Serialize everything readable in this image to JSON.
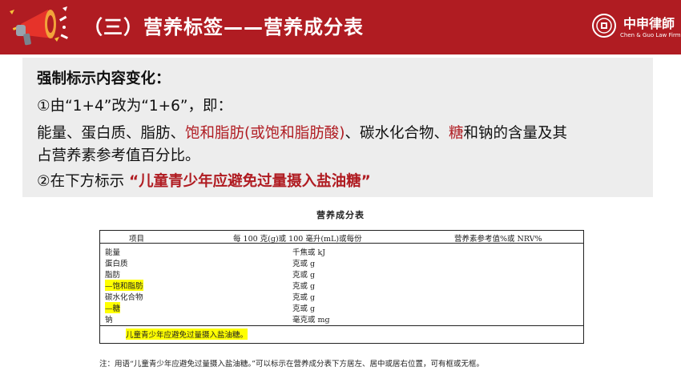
{
  "header": {
    "title": "（三）营养标签——营养成分表",
    "logo_cn": "中申律師",
    "logo_en": "Chen & Guo Law Firm"
  },
  "content": {
    "line1": "强制标示内容变化：",
    "line2": "①由“1+4”改为“1+6”，即：",
    "line3_a": "能量、蛋白质、脂肪、",
    "line3_b": "饱和脂肪(或饱和脂肪酸)",
    "line3_c": "、碳水化合物、",
    "line3_d": "糖",
    "line3_e": "和钠的含量及其",
    "line4": "占营养素参考值百分比。",
    "line5_a": "②在下方标示",
    "line5_b": "“儿童青少年应避免过量摄入盐油糖”"
  },
  "nutrition_table": {
    "title": "营养成分表",
    "headers": [
      "项目",
      "每 100 克(g)或 100 毫升(mL)或每份",
      "营养素参考值%或 NRV%"
    ],
    "rows": [
      {
        "name": "能量",
        "unit": "千焦或 kJ",
        "highlight": false
      },
      {
        "name": "蛋白质",
        "unit": "克或 g",
        "highlight": false
      },
      {
        "name": "脂肪",
        "unit": "克或 g",
        "highlight": false
      },
      {
        "name": "—饱和脂肪",
        "unit": "克或 g",
        "highlight": true
      },
      {
        "name": "碳水化合物",
        "unit": "克或 g",
        "highlight": false
      },
      {
        "name": "—糖",
        "unit": "克或 g",
        "highlight": true
      },
      {
        "name": "钠",
        "unit": "毫克或 mg",
        "highlight": false
      }
    ],
    "advice": "儿童青少年应避免过量摄入盐油糖。"
  },
  "note": "注：用语“儿童青少年应避免过量摄入盐油糖。”可以标示在营养成分表下方居左、居中或居右位置，可有框或无框。",
  "colors": {
    "brand_red": "#b01c22",
    "panel_bg": "#ededed",
    "highlight": "#ffff00"
  }
}
